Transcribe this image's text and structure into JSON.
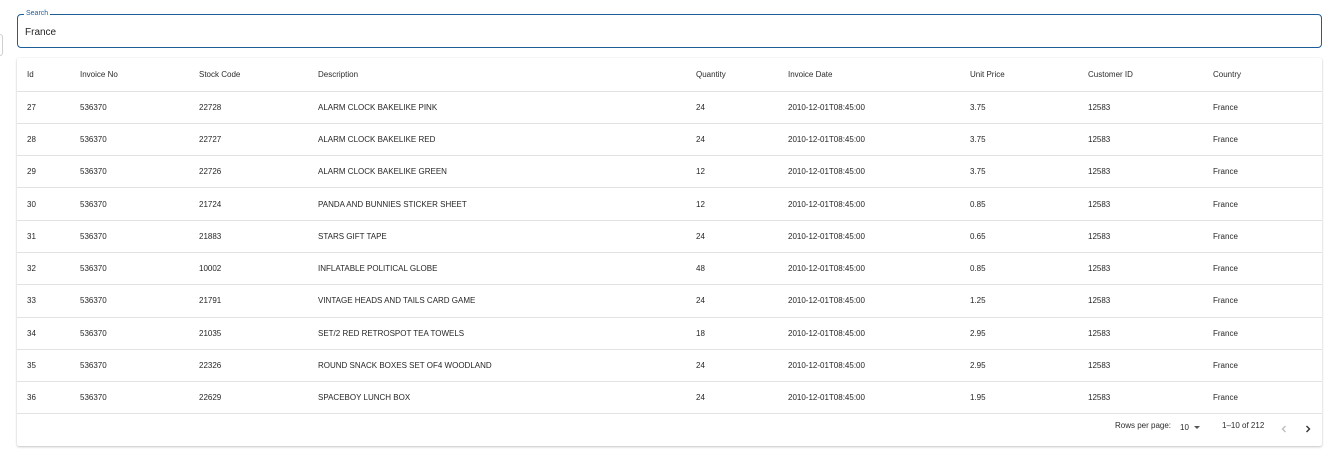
{
  "search": {
    "label": "Search",
    "value": "France"
  },
  "table": {
    "columns": [
      "Id",
      "Invoice No",
      "Stock Code",
      "Description",
      "Quantity",
      "Invoice Date",
      "Unit Price",
      "Customer ID",
      "Country"
    ],
    "rows": [
      [
        "27",
        "536370",
        "22728",
        "ALARM CLOCK BAKELIKE PINK",
        "24",
        "2010-12-01T08:45:00",
        "3.75",
        "12583",
        "France"
      ],
      [
        "28",
        "536370",
        "22727",
        "ALARM CLOCK BAKELIKE RED",
        "24",
        "2010-12-01T08:45:00",
        "3.75",
        "12583",
        "France"
      ],
      [
        "29",
        "536370",
        "22726",
        "ALARM CLOCK BAKELIKE GREEN",
        "12",
        "2010-12-01T08:45:00",
        "3.75",
        "12583",
        "France"
      ],
      [
        "30",
        "536370",
        "21724",
        "PANDA AND BUNNIES STICKER SHEET",
        "12",
        "2010-12-01T08:45:00",
        "0.85",
        "12583",
        "France"
      ],
      [
        "31",
        "536370",
        "21883",
        "STARS GIFT TAPE",
        "24",
        "2010-12-01T08:45:00",
        "0.65",
        "12583",
        "France"
      ],
      [
        "32",
        "536370",
        "10002",
        "INFLATABLE POLITICAL GLOBE",
        "48",
        "2010-12-01T08:45:00",
        "0.85",
        "12583",
        "France"
      ],
      [
        "33",
        "536370",
        "21791",
        "VINTAGE HEADS AND TAILS CARD GAME",
        "24",
        "2010-12-01T08:45:00",
        "1.25",
        "12583",
        "France"
      ],
      [
        "34",
        "536370",
        "21035",
        "SET/2 RED RETROSPOT TEA TOWELS",
        "18",
        "2010-12-01T08:45:00",
        "2.95",
        "12583",
        "France"
      ],
      [
        "35",
        "536370",
        "22326",
        "ROUND SNACK BOXES SET OF4 WOODLAND",
        "24",
        "2010-12-01T08:45:00",
        "2.95",
        "12583",
        "France"
      ],
      [
        "36",
        "536370",
        "22629",
        "SPACEBOY LUNCH BOX",
        "24",
        "2010-12-01T08:45:00",
        "1.95",
        "12583",
        "France"
      ]
    ]
  },
  "pagination": {
    "rows_per_page_label": "Rows per page:",
    "rows_per_page_value": "10",
    "range_label": "1–10 of 212",
    "prev_icon": "chevron-left-icon",
    "next_icon": "chevron-right-icon"
  },
  "colors": {
    "accent": "#1d5e99",
    "disabled_icon": "#bdbdbd",
    "active_icon": "#333333"
  }
}
